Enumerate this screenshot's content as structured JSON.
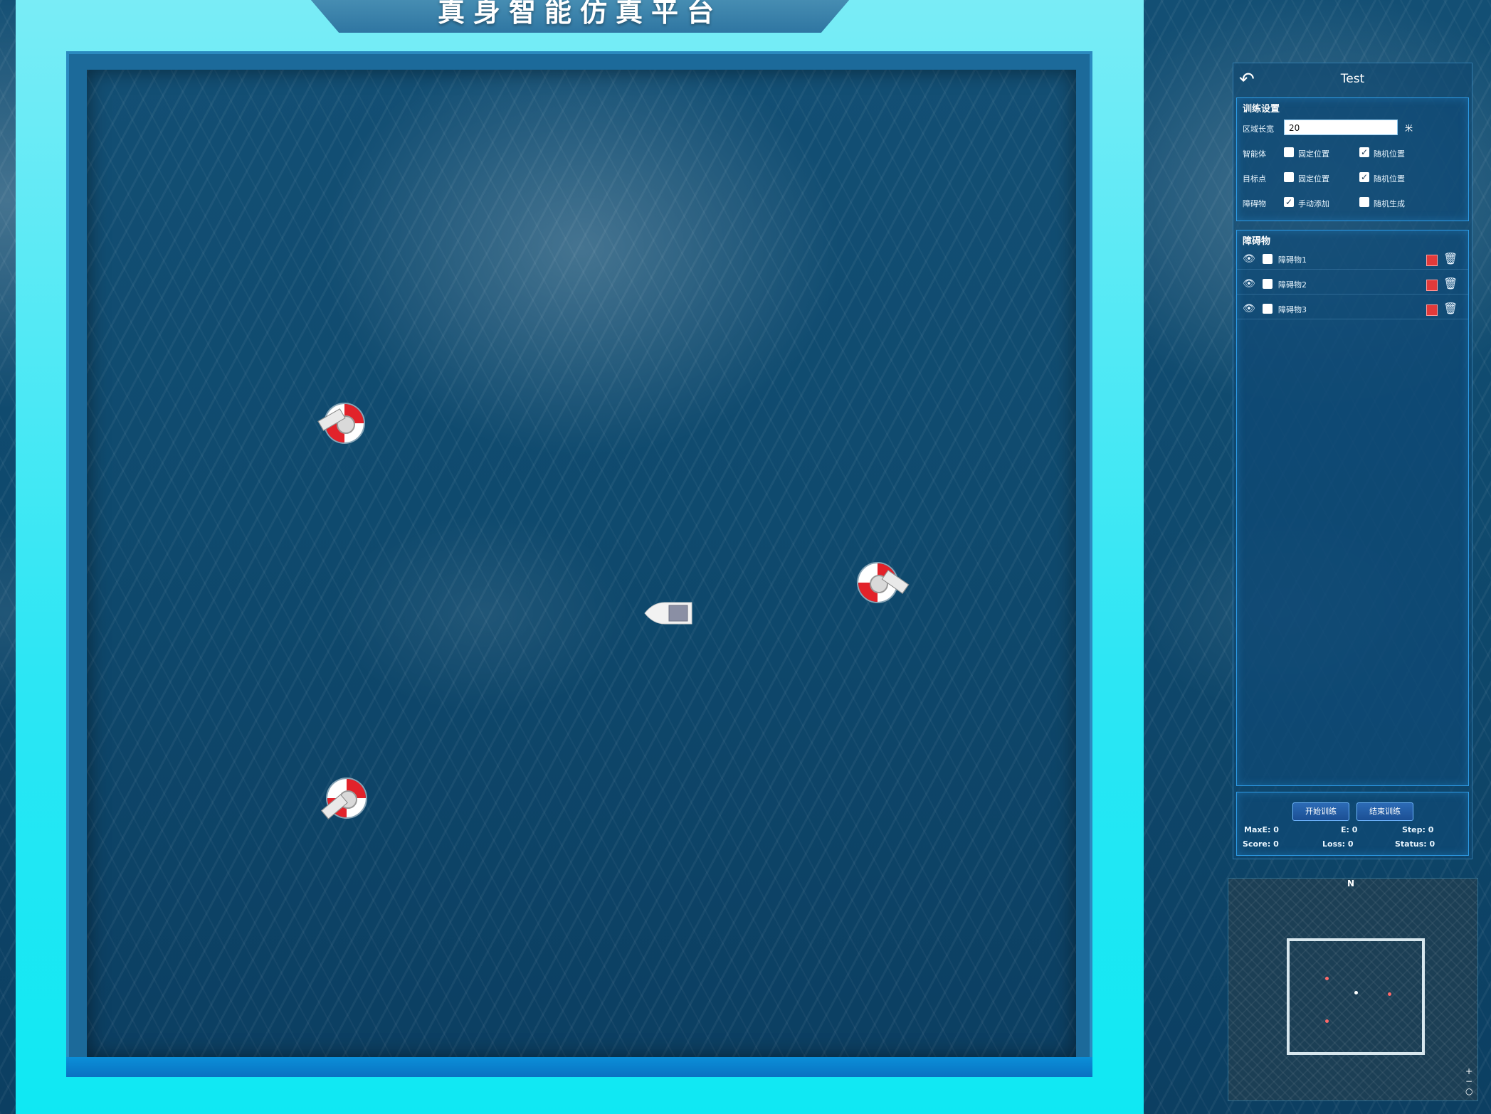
{
  "scene": {
    "title": "真身智能仿真平台",
    "objects": [
      "buoy",
      "buoy",
      "buoy",
      "boat"
    ]
  },
  "panel": {
    "title": "Test",
    "back_icon": "back-arrow-icon",
    "training": {
      "section_title": "训练设置",
      "area_label": "区域长宽",
      "area_value": "20",
      "area_unit": "米",
      "rows": [
        {
          "label": "智能体",
          "opt1": "固定位置",
          "opt1_checked": false,
          "opt2": "随机位置",
          "opt2_checked": true
        },
        {
          "label": "目标点",
          "opt1": "固定位置",
          "opt1_checked": false,
          "opt2": "随机位置",
          "opt2_checked": true
        },
        {
          "label": "障碍物",
          "opt1": "手动添加",
          "opt1_checked": true,
          "opt2": "随机生成",
          "opt2_checked": false
        }
      ]
    },
    "obstacles": {
      "section_title": "障碍物",
      "items": [
        {
          "name": "障碍物1",
          "color": "#e23a3a"
        },
        {
          "name": "障碍物2",
          "color": "#e23a3a"
        },
        {
          "name": "障碍物3",
          "color": "#e23a3a"
        }
      ]
    },
    "controls": {
      "start_label": "开始训练",
      "stop_label": "结束训练"
    },
    "stats": {
      "maxe": "MaxE: 0",
      "e": "E: 0",
      "step": "Step: 0",
      "score": "Score: 0",
      "loss": "Loss: 0",
      "status": "Status: 0"
    }
  },
  "minimap": {
    "north": "N",
    "zoom_in": "+",
    "zoom_out": "−",
    "reset": "○"
  },
  "colors": {
    "frame": "#0fe8f3",
    "accent": "#2d9be6",
    "buoy_red": "#e2222a"
  }
}
